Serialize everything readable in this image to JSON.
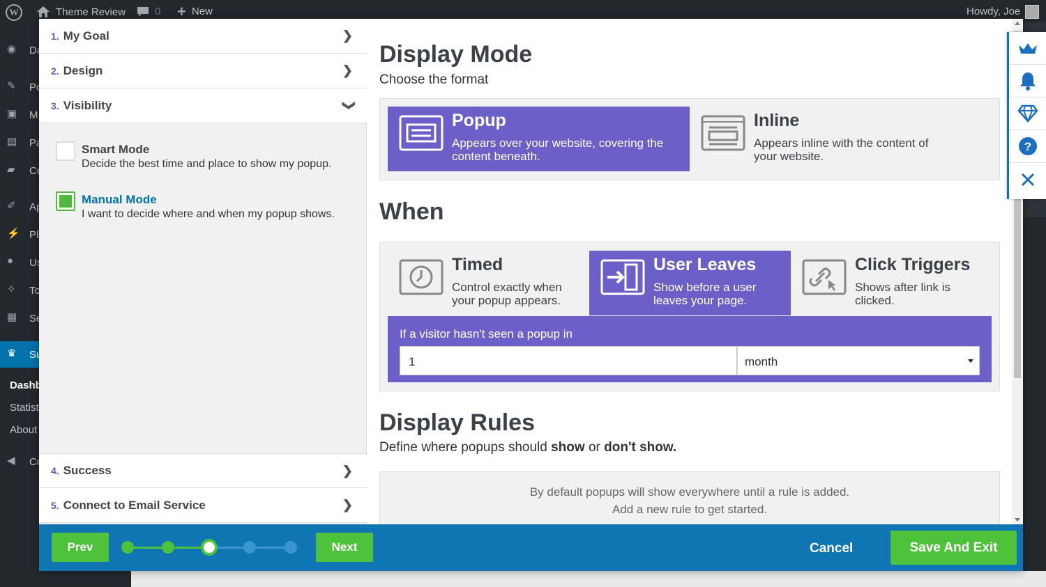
{
  "adminbar": {
    "site_name": "Theme Review",
    "comments_count": "0",
    "new_label": "New",
    "howdy": "Howdy, Joe"
  },
  "sidemenu": {
    "items": [
      "Da",
      "Po",
      "M",
      "Pa",
      "Co",
      "Ap",
      "Pl",
      "Us",
      "To",
      "Se",
      "Su",
      "Co"
    ],
    "submenu": [
      "Dashb",
      "Statist",
      "About"
    ]
  },
  "steps": [
    {
      "num": "1.",
      "label": "My Goal"
    },
    {
      "num": "2.",
      "label": "Design"
    },
    {
      "num": "3.",
      "label": "Visibility"
    },
    {
      "num": "4.",
      "label": "Success"
    },
    {
      "num": "5.",
      "label": "Connect to Email Service"
    }
  ],
  "visibility_options": [
    {
      "title": "Smart Mode",
      "desc": "Decide the best time and place to show my popup.",
      "checked": false
    },
    {
      "title": "Manual Mode",
      "desc": "I want to decide where and when my popup shows.",
      "checked": true
    }
  ],
  "display_mode": {
    "heading": "Display Mode",
    "subheading": "Choose the format",
    "options": [
      {
        "title": "Popup",
        "desc": "Appears over your website, covering the content beneath.",
        "selected": true,
        "icon": "popup-window-icon"
      },
      {
        "title": "Inline",
        "desc": "Appears inline with the content of your website.",
        "selected": false,
        "icon": "inline-content-icon"
      }
    ]
  },
  "when": {
    "heading": "When",
    "options": [
      {
        "title": "Timed",
        "desc": "Control exactly when your popup appears.",
        "selected": false,
        "icon": "clock-icon"
      },
      {
        "title": "User Leaves",
        "desc": "Show before a user leaves your page.",
        "selected": true,
        "icon": "exit-door-icon"
      },
      {
        "title": "Click Triggers",
        "desc": "Shows after link is clicked.",
        "selected": false,
        "icon": "link-cursor-icon"
      }
    ],
    "frequency_label": "If a visitor hasn't seen a popup in",
    "frequency_value": "1",
    "frequency_unit": "month"
  },
  "display_rules": {
    "heading": "Display Rules",
    "sub_prefix": "Define where popups should ",
    "sub_show": "show",
    "sub_or": " or ",
    "sub_dont": "don't show.",
    "empty_line1": "By default popups will show everywhere until a rule is added.",
    "empty_line2": "Add a new rule to get started."
  },
  "footer": {
    "prev": "Prev",
    "next": "Next",
    "cancel": "Cancel",
    "save": "Save And Exit",
    "current_step": 3,
    "total_steps": 5
  },
  "toolbar": {
    "icons": [
      "crown-icon",
      "bell-icon",
      "diamond-icon",
      "help-icon",
      "close-icon"
    ]
  },
  "colors": {
    "accent_purple": "#6c5fc7",
    "green": "#4fc23c",
    "footer_blue": "#0f76b3",
    "link_blue": "#0073aa"
  }
}
